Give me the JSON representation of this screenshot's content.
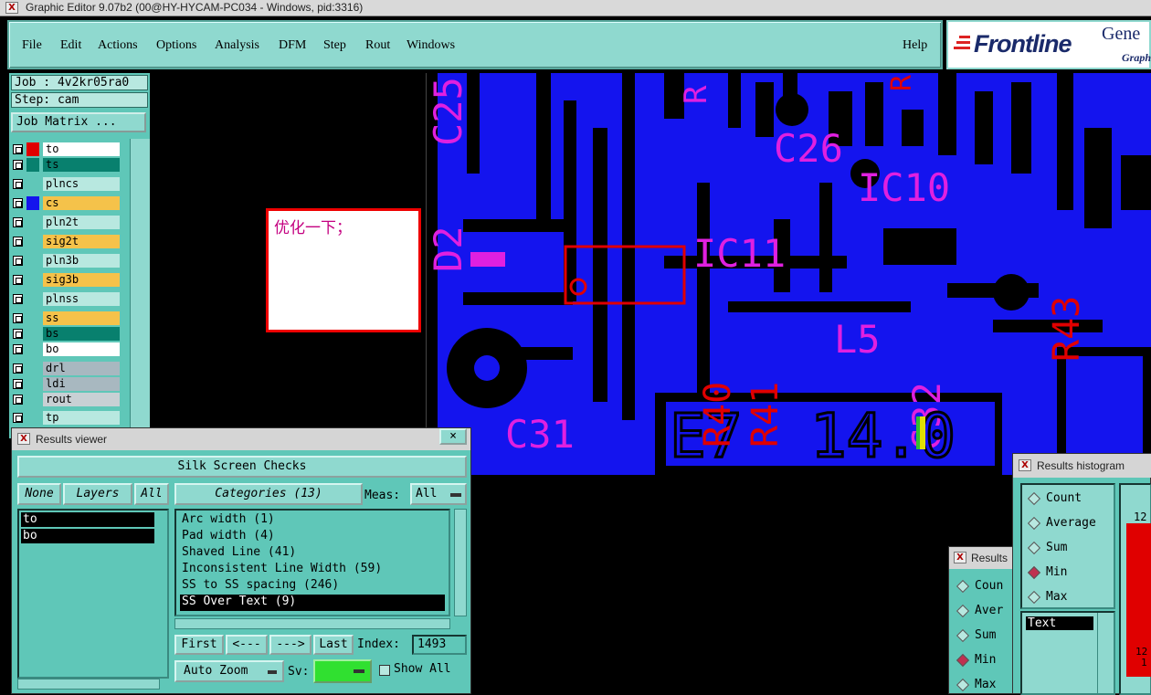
{
  "window": {
    "title": "Graphic Editor 9.07b2 (00@HY-HYCAM-PC034 - Windows, pid:3316)",
    "icon_glyph": "X"
  },
  "menu": {
    "items": [
      "File",
      "Edit",
      "Actions",
      "Options",
      "Analysis",
      "DFM",
      "Step",
      "Rout",
      "Windows"
    ],
    "help": "Help"
  },
  "logo": {
    "text": "Frontline",
    "gen": "Gene",
    "sub": "Graph"
  },
  "job": {
    "job_label": "Job : 4v2kr05ra0",
    "step_label": "Step: cam",
    "matrix_button": "Job Matrix ..."
  },
  "layers": [
    {
      "name": "to",
      "swatch": "#e00000",
      "bg": "#ffffff",
      "active": true
    },
    {
      "name": "ts",
      "swatch": "#08806e",
      "bg": "#08806e"
    },
    {
      "name": "plncs",
      "swatch": "#5fc7b8",
      "bg": "#b8e8e0"
    },
    {
      "name": "cs",
      "swatch": "#1414ee",
      "bg": "#f5c24a"
    },
    {
      "name": "pln2t",
      "swatch": "#5fc7b8",
      "bg": "#b8e8e0"
    },
    {
      "name": "sig2t",
      "swatch": "#5fc7b8",
      "bg": "#f5c24a"
    },
    {
      "name": "pln3b",
      "swatch": "#5fc7b8",
      "bg": "#b8e8e0"
    },
    {
      "name": "sig3b",
      "swatch": "#5fc7b8",
      "bg": "#f5c24a"
    },
    {
      "name": "plnss",
      "swatch": "#5fc7b8",
      "bg": "#b8e8e0"
    },
    {
      "name": "ss",
      "swatch": "#5fc7b8",
      "bg": "#f5c24a"
    },
    {
      "name": "bs",
      "swatch": "#5fc7b8",
      "bg": "#08806e"
    },
    {
      "name": "bo",
      "swatch": "#5fc7b8",
      "bg": "#ffffff"
    },
    {
      "name": "drl",
      "swatch": "#5fc7b8",
      "bg": "#a8b8c0"
    },
    {
      "name": "ldi",
      "swatch": "#5fc7b8",
      "bg": "#a8b8c0"
    },
    {
      "name": "rout",
      "swatch": "#5fc7b8",
      "bg": "#c8d0d4"
    },
    {
      "name": "tp",
      "swatch": "#5fc7b8",
      "bg": "#b8e8e0"
    }
  ],
  "note": {
    "text": "优化一下；"
  },
  "pcb_labels": [
    "C25",
    "R",
    "R",
    "R",
    "C26",
    "IC10",
    "D2",
    "IC11",
    "R43",
    "L5",
    "R40",
    "R41",
    "C32",
    "C31",
    "E7",
    "14.0"
  ],
  "results_viewer": {
    "title": "Results viewer",
    "close_glyph": "×",
    "heading": "Silk Screen Checks",
    "none_btn": "None",
    "layers_btn": "Layers",
    "all_btn": "All",
    "layer_list": [
      "to",
      "bo"
    ],
    "categories_btn": "Categories (13)",
    "meas_label": "Meas:",
    "meas_value": "All",
    "categories": [
      "Arc width (1)",
      "Pad width (4)",
      "Shaved Line (41)",
      "Inconsistent Line Width (59)",
      "SS to SS spacing (246)",
      "SS Over Text (9)"
    ],
    "selected_category": "SS Over Text (9)",
    "first_btn": "First",
    "prev_btn": "<---",
    "next_btn": "--->",
    "last_btn": "Last",
    "index_label": "Index:",
    "index_value": "1493",
    "autozoom_btn": "Auto Zoom",
    "sv_label": "Sv:",
    "sv_color": "#30e030",
    "show_all_label": "Show All"
  },
  "results_histogram": {
    "title": "Results histogram",
    "options": [
      "Count",
      "Average",
      "Sum",
      "Min",
      "Max"
    ],
    "selected": "Min",
    "field_label": "Text",
    "bar_top_value": "12",
    "bar_bottom_values": [
      "12",
      "1"
    ]
  },
  "results_small": {
    "title": "Results",
    "options": [
      "Coun",
      "Aver",
      "Sum",
      "Min",
      "Max"
    ],
    "selected": "Min"
  },
  "colors": {
    "accent": "#8fd9cf",
    "panel": "#5fc7b8",
    "board": "#1414ee",
    "silk": "#e020e0",
    "mark": "#e00000"
  }
}
